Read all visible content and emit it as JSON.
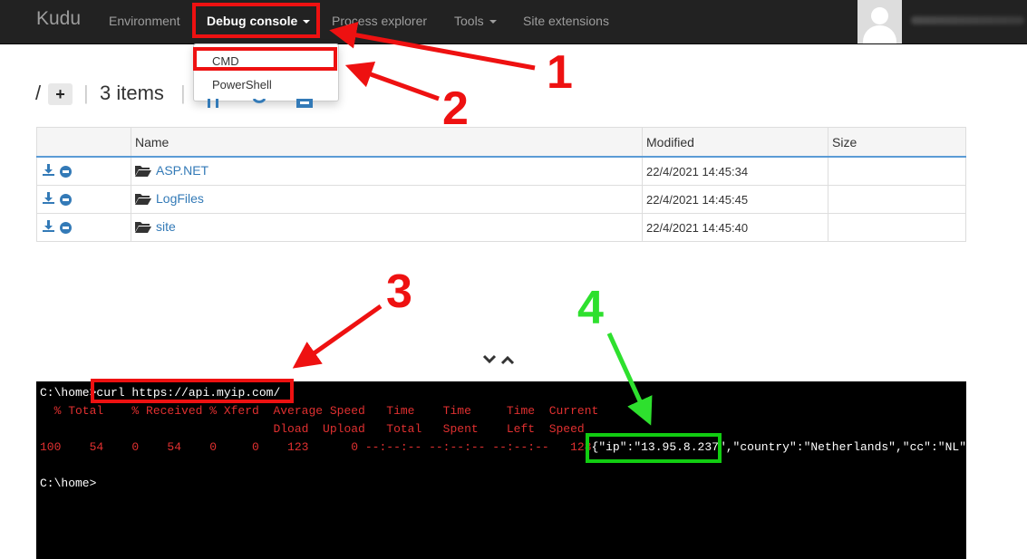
{
  "navbar": {
    "brand": "Kudu",
    "items": [
      {
        "label": "Environment"
      },
      {
        "label": "Debug console"
      },
      {
        "label": "Process explorer"
      },
      {
        "label": "Tools"
      },
      {
        "label": "Site extensions"
      }
    ]
  },
  "dropdown": {
    "items": [
      "CMD",
      "PowerShell"
    ]
  },
  "toolbar": {
    "path": "/",
    "add_label": "+",
    "items_count": "3 items"
  },
  "table": {
    "columns": [
      "",
      "Name",
      "Modified",
      "Size"
    ],
    "rows": [
      {
        "name": "ASP.NET",
        "modified": "22/4/2021 14:45:34",
        "size": ""
      },
      {
        "name": "LogFiles",
        "modified": "22/4/2021 14:45:45",
        "size": ""
      },
      {
        "name": "site",
        "modified": "22/4/2021 14:45:40",
        "size": ""
      }
    ]
  },
  "console": {
    "prompt": "C:\\home>",
    "command": "curl https://api.myip.com/",
    "header1": "  % Total    % Received % Xferd  Average Speed   Time    Time     Time  Current",
    "header2": "                                 Dload  Upload   Total   Spent    Left  Speed",
    "progress": "100    54    0    54    0     0    123      0 --:--:-- --:--:-- --:--:--   128",
    "json_start": "{",
    "json_ip": "\"ip\":\"13.95.8.237\"",
    "json_rest": ",\"country\":\"Netherlands\",\"cc\":\"NL\"}",
    "prompt2": "C:\\home>"
  },
  "annotations": {
    "step1": "1",
    "step2": "2",
    "step3": "3",
    "step4": "4"
  },
  "colors": {
    "navbar_bg": "#222222",
    "link_blue": "#337ab7",
    "annotation_red": "#ee1111",
    "annotation_green": "#11cc11",
    "console_bg": "#000000"
  }
}
